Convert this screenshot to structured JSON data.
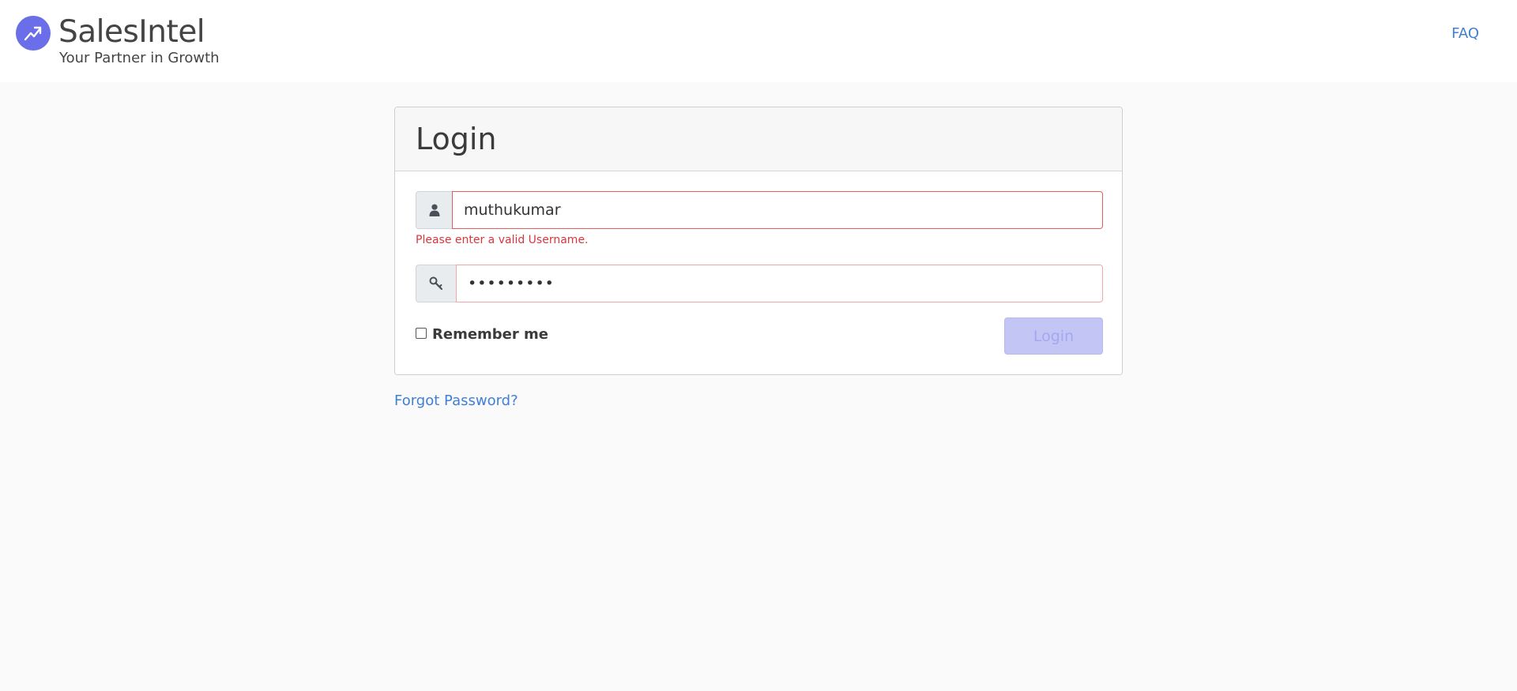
{
  "header": {
    "brand_name": "SalesIntel",
    "tagline": "Your Partner in Growth",
    "faq_label": "FAQ",
    "logo_icon": "trend-up-arrow-icon"
  },
  "login_form": {
    "title": "Login",
    "username": {
      "value": "muthukumar",
      "icon": "user-icon",
      "error": "Please enter a valid Username."
    },
    "password": {
      "value": "•••••••••",
      "icon": "key-icon"
    },
    "remember_label": "Remember me",
    "remember_checked": false,
    "login_button_label": "Login",
    "forgot_password_label": "Forgot Password?"
  },
  "colors": {
    "brand": "#6a6ee8",
    "link": "#3f7fd6",
    "error": "#d9363e",
    "button_disabled": "#c3c6f5"
  }
}
